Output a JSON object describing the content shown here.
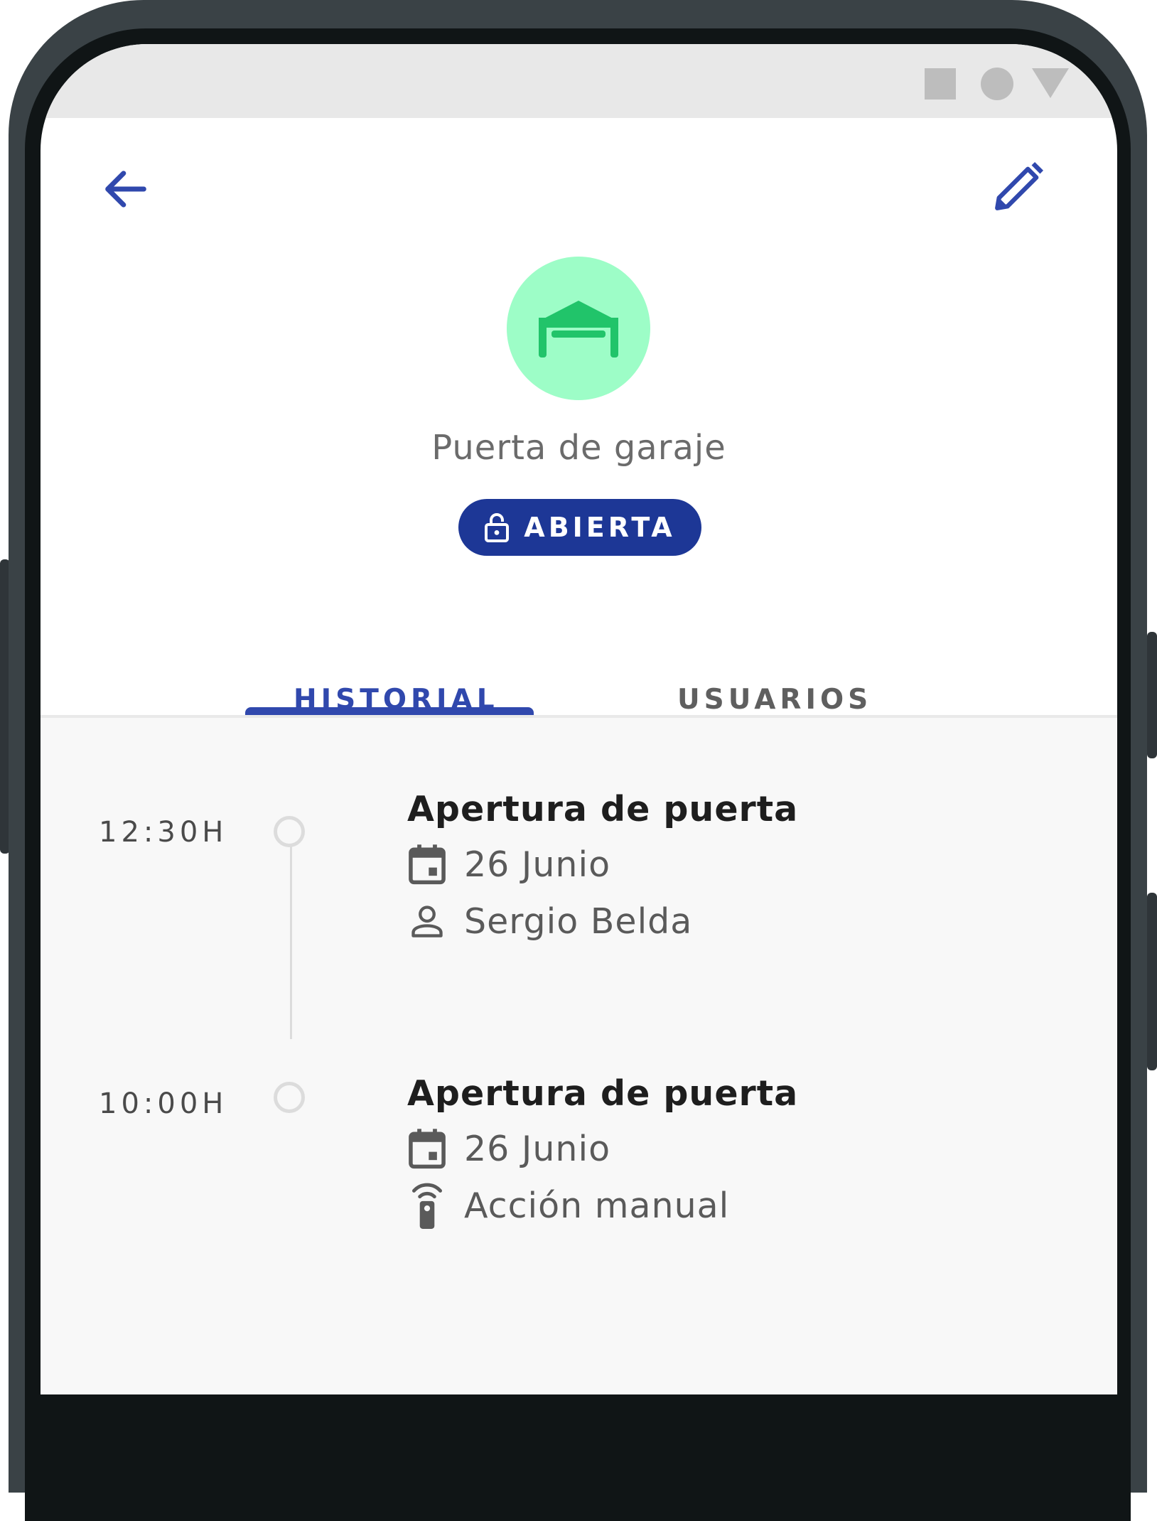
{
  "app_bar": {
    "back_icon": "arrow-left-icon",
    "edit_icon": "pencil-icon"
  },
  "device": {
    "icon": "garage-icon",
    "name": "Puerta de garaje",
    "status_icon": "unlocked-padlock-icon",
    "status_label": "ABIERTA"
  },
  "tabs": [
    {
      "label": "HISTORIAL",
      "active": true
    },
    {
      "label": "USUARIOS",
      "active": false
    }
  ],
  "history": [
    {
      "time": "12:30H",
      "title": "Apertura de puerta",
      "date": "26 Junio",
      "detail": "Sergio Belda",
      "detail_icon": "person-icon"
    },
    {
      "time": "10:00H",
      "title": "Apertura de puerta",
      "date": "26 Junio",
      "detail": "Acción manual",
      "detail_icon": "remote-control-icon"
    }
  ],
  "colors": {
    "primary": "#3048ad",
    "badge_bg": "#1d3796",
    "avatar_bg": "#9dfdc7",
    "avatar_icon": "#21c46a"
  }
}
